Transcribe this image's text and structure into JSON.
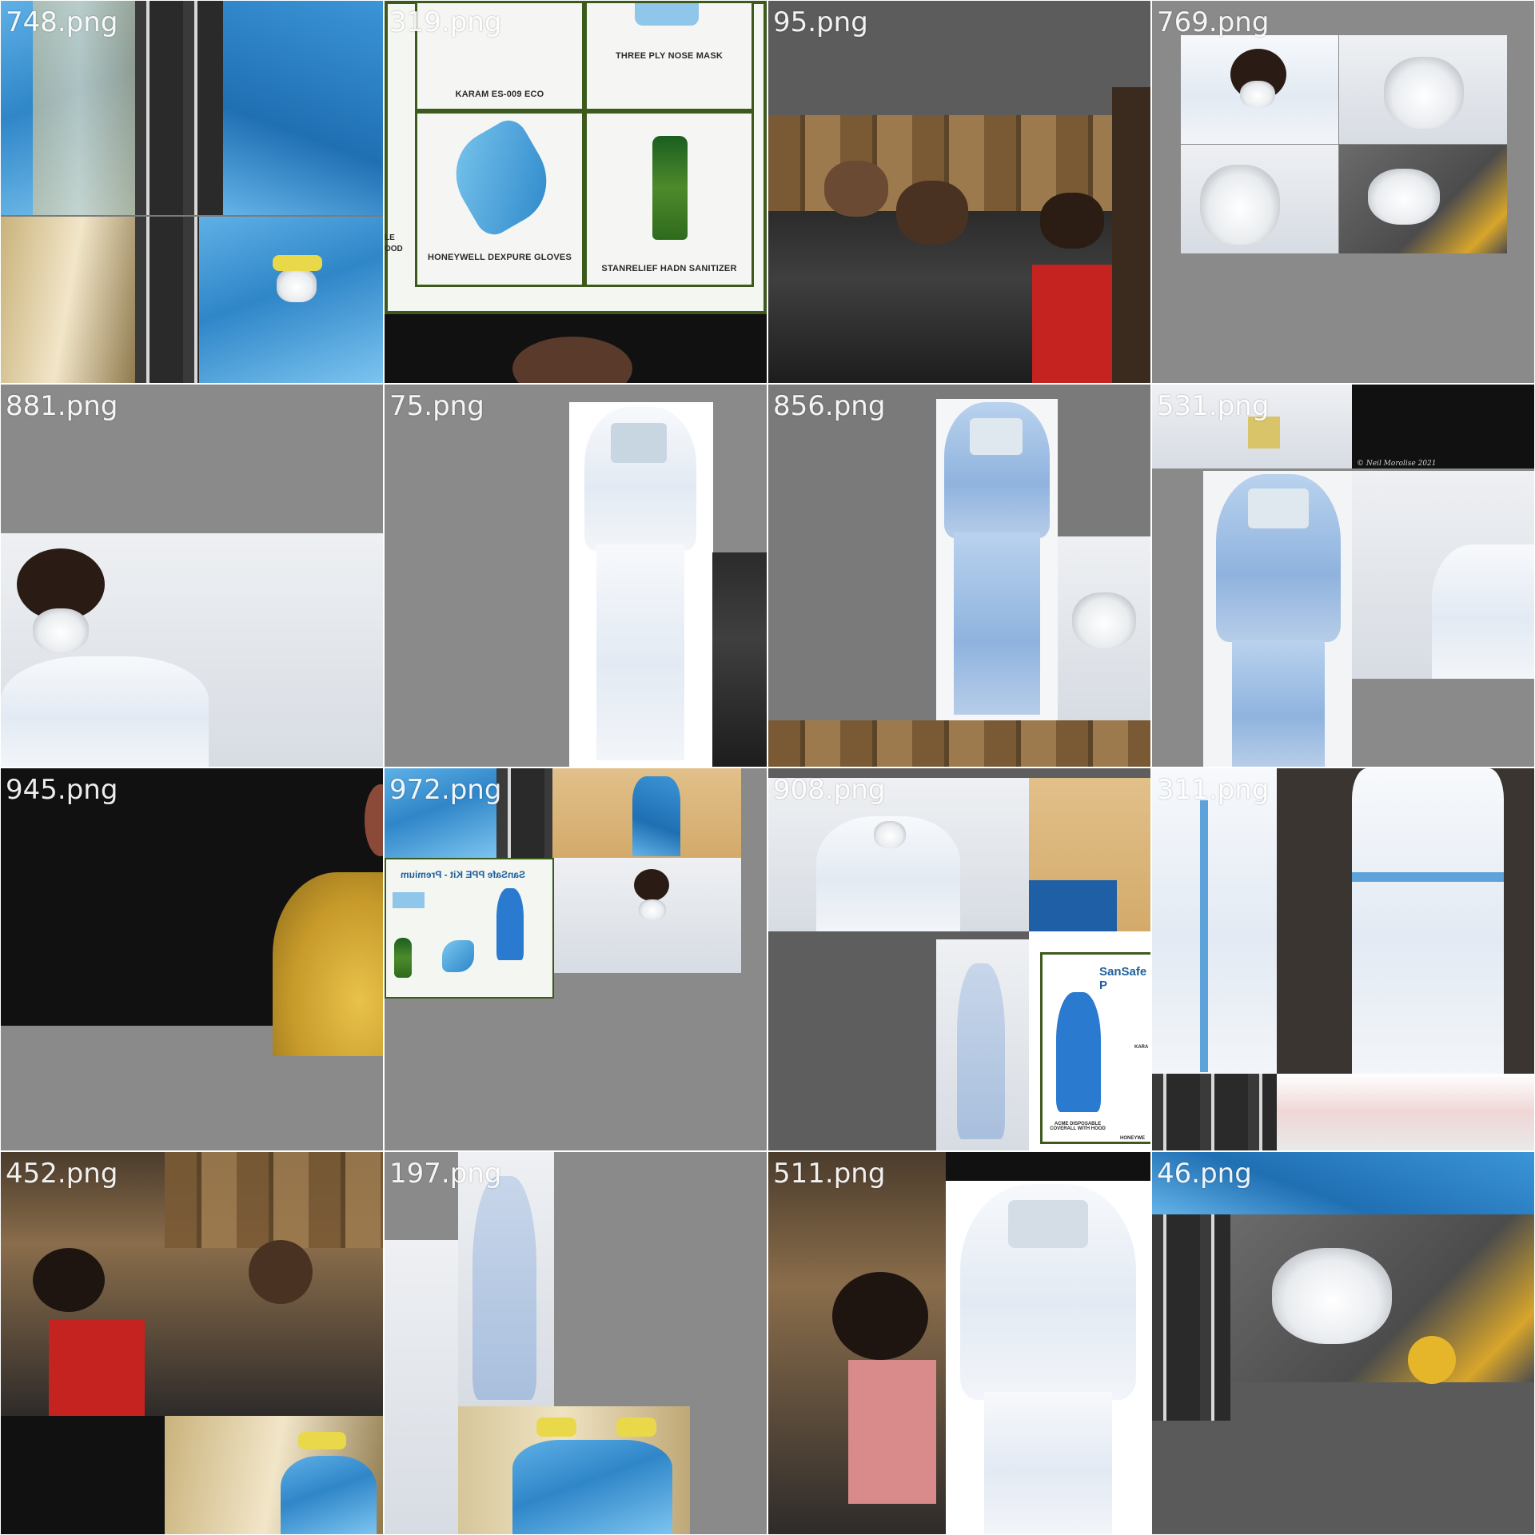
{
  "tiles": [
    {
      "label": "748.png"
    },
    {
      "label": "319.png"
    },
    {
      "label": "95.png"
    },
    {
      "label": "769.png"
    },
    {
      "label": "881.png"
    },
    {
      "label": "75.png"
    },
    {
      "label": "856.png"
    },
    {
      "label": "531.png"
    },
    {
      "label": "945.png"
    },
    {
      "label": "972.png"
    },
    {
      "label": "908.png"
    },
    {
      "label": "311.png"
    },
    {
      "label": "452.png"
    },
    {
      "label": "197.png"
    },
    {
      "label": "511.png"
    },
    {
      "label": "46.png"
    }
  ],
  "poster_319": {
    "items": [
      "KARAM ES-009 ECO",
      "THREE PLY NOSE MASK",
      "HONEYWELL DEXPURE GLOVES",
      "STANRELIEF HADN SANITIZER"
    ],
    "partial_left": "LE\nOOD"
  },
  "poster_972": {
    "title": "SanSafe PPE Kit - Premium"
  },
  "poster_908": {
    "title": "SanSafe P",
    "item_left": "ACME DISPOSABLE COVERALL WITH HOOD",
    "item_right": "HONEYWE",
    "item_top_right": "KARA"
  },
  "watermark_531": "© Neil Morolise 2021"
}
